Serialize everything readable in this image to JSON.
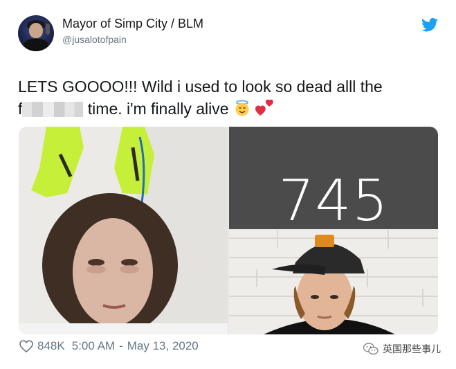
{
  "author": {
    "display_name": "Mayor of Simp City / BLM",
    "handle": "@jusalotofpain"
  },
  "tweet": {
    "text_part1": "LETS GOOOO!!! Wild i used to look so dead alll the",
    "text_part2_prefix": "f",
    "text_part2_suffix": " time. i'm finally alive ",
    "emojis": [
      "smiling-face-with-halo",
      "two-hearts"
    ]
  },
  "media": {
    "score": "745"
  },
  "footer": {
    "likes": "848K",
    "time": "5:00 AM",
    "separator": "-",
    "date": "May 13, 2020"
  },
  "watermark": {
    "text": "英国那些事儿"
  },
  "colors": {
    "twitter_blue": "#1da1f2",
    "text": "#14171a",
    "secondary": "#657786",
    "score_bg": "#4b4b4b"
  }
}
